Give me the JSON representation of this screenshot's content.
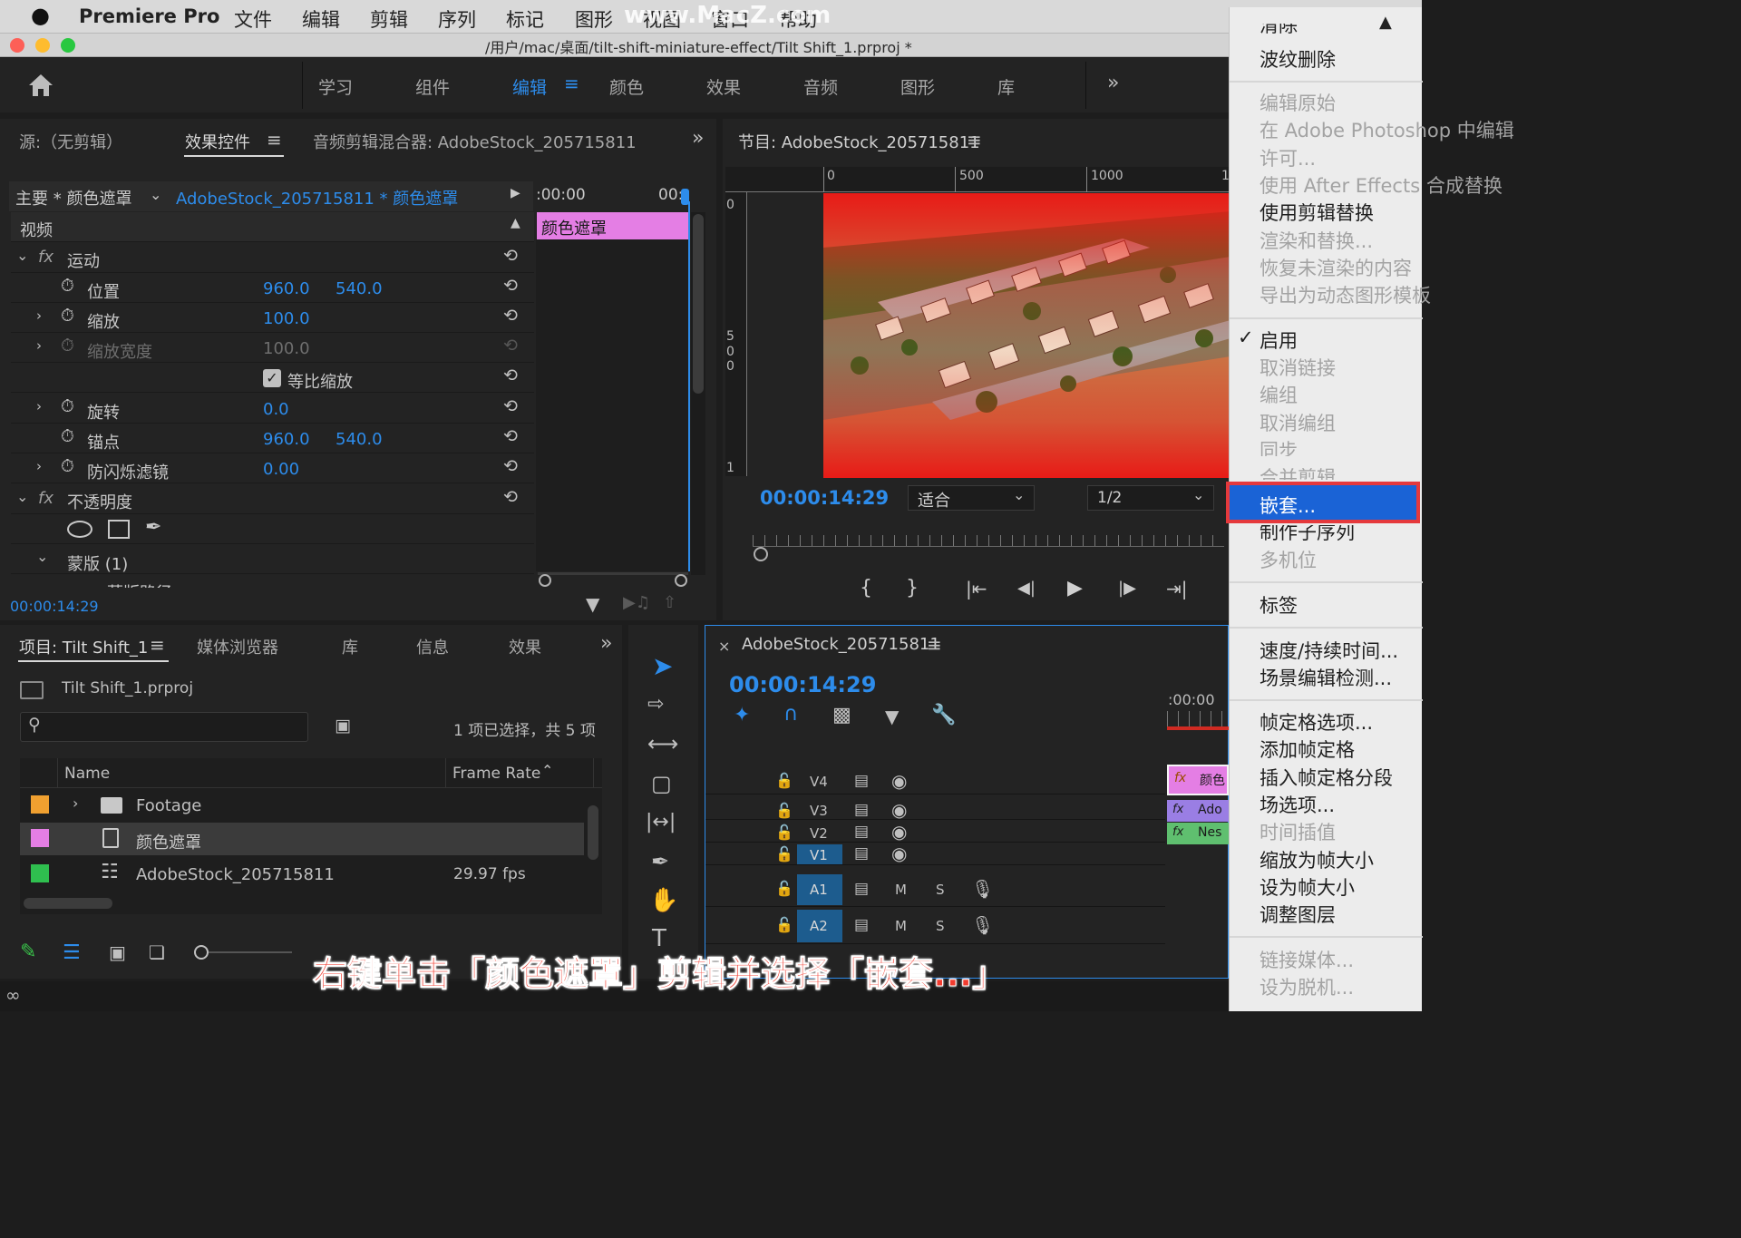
{
  "menubar": {
    "app_name": "Premiere Pro",
    "items": [
      "文件",
      "编辑",
      "剪辑",
      "序列",
      "标记",
      "图形",
      "视图",
      "窗口",
      "帮助"
    ],
    "watermark": "www.MacZ.com"
  },
  "titlebar": {
    "path": "/用户/mac/桌面/tilt-shift-miniature-effect/Tilt Shift_1.prproj *"
  },
  "workspaces": {
    "tabs": [
      "学习",
      "组件",
      "编辑",
      "颜色",
      "效果",
      "音频",
      "图形",
      "库"
    ],
    "active": "编辑"
  },
  "source_panel": {
    "tabs": [
      "源:（无剪辑）",
      "效果控件",
      "音频剪辑混合器: AdobeStock_205715811"
    ],
    "clip_header": {
      "master": "主要 * 颜色遮罩",
      "sequence_clip": "AdobeStock_205715811 * 颜色遮罩",
      "tl_start": ":00:00",
      "tl_end": "00:"
    },
    "video_label": "视频",
    "clip_bar_label": "颜色遮罩",
    "motion": "运动",
    "props": [
      {
        "name": "位置",
        "v1": "960.0",
        "v2": "540.0"
      },
      {
        "name": "缩放",
        "v1": "100.0",
        "v2": ""
      },
      {
        "name": "缩放宽度",
        "v1": "100.0",
        "v2": ""
      },
      {
        "name": "等比缩放",
        "v1": "",
        "v2": ""
      },
      {
        "name": "旋转",
        "v1": "0.0",
        "v2": ""
      },
      {
        "name": "锚点",
        "v1": "960.0",
        "v2": "540.0"
      },
      {
        "name": "防闪烁滤镜",
        "v1": "0.00",
        "v2": ""
      }
    ],
    "opacity": "不透明度",
    "mask": "蒙版 (1)",
    "mask_path_partial": "蒙版路径",
    "timecode": "00:00:14:29"
  },
  "program_panel": {
    "title": "节目: AdobeStock_205715811",
    "ruler_top": [
      "0",
      "500",
      "1000",
      "1"
    ],
    "ruler_left": [
      "0",
      "5",
      "0",
      "0",
      "1"
    ],
    "timecode": "00:00:14:29",
    "fit": "适合",
    "resolution": "1/2"
  },
  "project_panel": {
    "tabs": [
      "项目: Tilt Shift_1",
      "媒体浏览器",
      "库",
      "信息",
      "效果"
    ],
    "file": "Tilt Shift_1.prproj",
    "selection_info": "1 项已选择，共 5 项",
    "search_placeholder": "",
    "col_name": "Name",
    "col_framerate": "Frame Rate",
    "items": [
      {
        "name": "Footage",
        "color": "#f0a030",
        "rate": ""
      },
      {
        "name": "颜色遮罩",
        "color": "#e47ee4",
        "rate": ""
      },
      {
        "name": "AdobeStock_205715811",
        "color": "#2fbf4f",
        "rate": "29.97 fps"
      }
    ]
  },
  "timeline_panel": {
    "title": "AdobeStock_205715811",
    "timecode": "00:00:14:29",
    "ruler_start": ":00:00",
    "tracks": [
      "V4",
      "V3",
      "V2",
      "V1",
      "A1",
      "A2"
    ],
    "track_m": "M",
    "track_s": "S",
    "clips": [
      {
        "label": "颜色",
        "color": "#e47ee4"
      },
      {
        "label": "Ado",
        "color": "#9a7ee4"
      },
      {
        "label": "Nes",
        "color": "#5fbf6f"
      }
    ]
  },
  "context_menu": {
    "items": [
      {
        "label": "波纹删除",
        "enabled": true
      },
      {
        "label": "编辑原始",
        "enabled": false
      },
      {
        "label": "在 Adobe Photoshop 中编辑",
        "enabled": false
      },
      {
        "label": "许可...",
        "enabled": false
      },
      {
        "label": "使用 After Effects 合成替换",
        "enabled": false
      },
      {
        "label": "使用剪辑替换",
        "enabled": true
      },
      {
        "label": "渲染和替换...",
        "enabled": false
      },
      {
        "label": "恢复未渲染的内容",
        "enabled": false
      },
      {
        "label": "导出为动态图形模板",
        "enabled": false
      },
      {
        "label": "启用",
        "enabled": true,
        "checked": true
      },
      {
        "label": "取消链接",
        "enabled": false
      },
      {
        "label": "编组",
        "enabled": false
      },
      {
        "label": "取消编组",
        "enabled": false
      },
      {
        "label": "同步",
        "enabled": false
      },
      {
        "label": "合并剪辑",
        "enabled": false
      },
      {
        "label": "嵌套...",
        "enabled": true,
        "highlighted": true
      },
      {
        "label": "制作子序列",
        "enabled": true
      },
      {
        "label": "多机位",
        "enabled": false
      },
      {
        "label": "标签",
        "enabled": true
      },
      {
        "label": "速度/持续时间...",
        "enabled": true
      },
      {
        "label": "场景编辑检测...",
        "enabled": true
      },
      {
        "label": "帧定格选项...",
        "enabled": true
      },
      {
        "label": "添加帧定格",
        "enabled": true
      },
      {
        "label": "插入帧定格分段",
        "enabled": true
      },
      {
        "label": "场选项...",
        "enabled": true
      },
      {
        "label": "时间插值",
        "enabled": false
      },
      {
        "label": "缩放为帧大小",
        "enabled": true
      },
      {
        "label": "设为帧大小",
        "enabled": true
      },
      {
        "label": "调整图层",
        "enabled": true
      },
      {
        "label": "链接媒体...",
        "enabled": false
      },
      {
        "label": "设为脱机...",
        "enabled": false
      }
    ],
    "partial_top": "清除"
  },
  "caption": "右键单击「颜色遮罩」剪辑并选择「嵌套...」",
  "colors": {
    "accent": "#2d8ceb",
    "highlight": "#1a63d6",
    "callout": "#e5393c",
    "caption": "#f23c2f"
  }
}
